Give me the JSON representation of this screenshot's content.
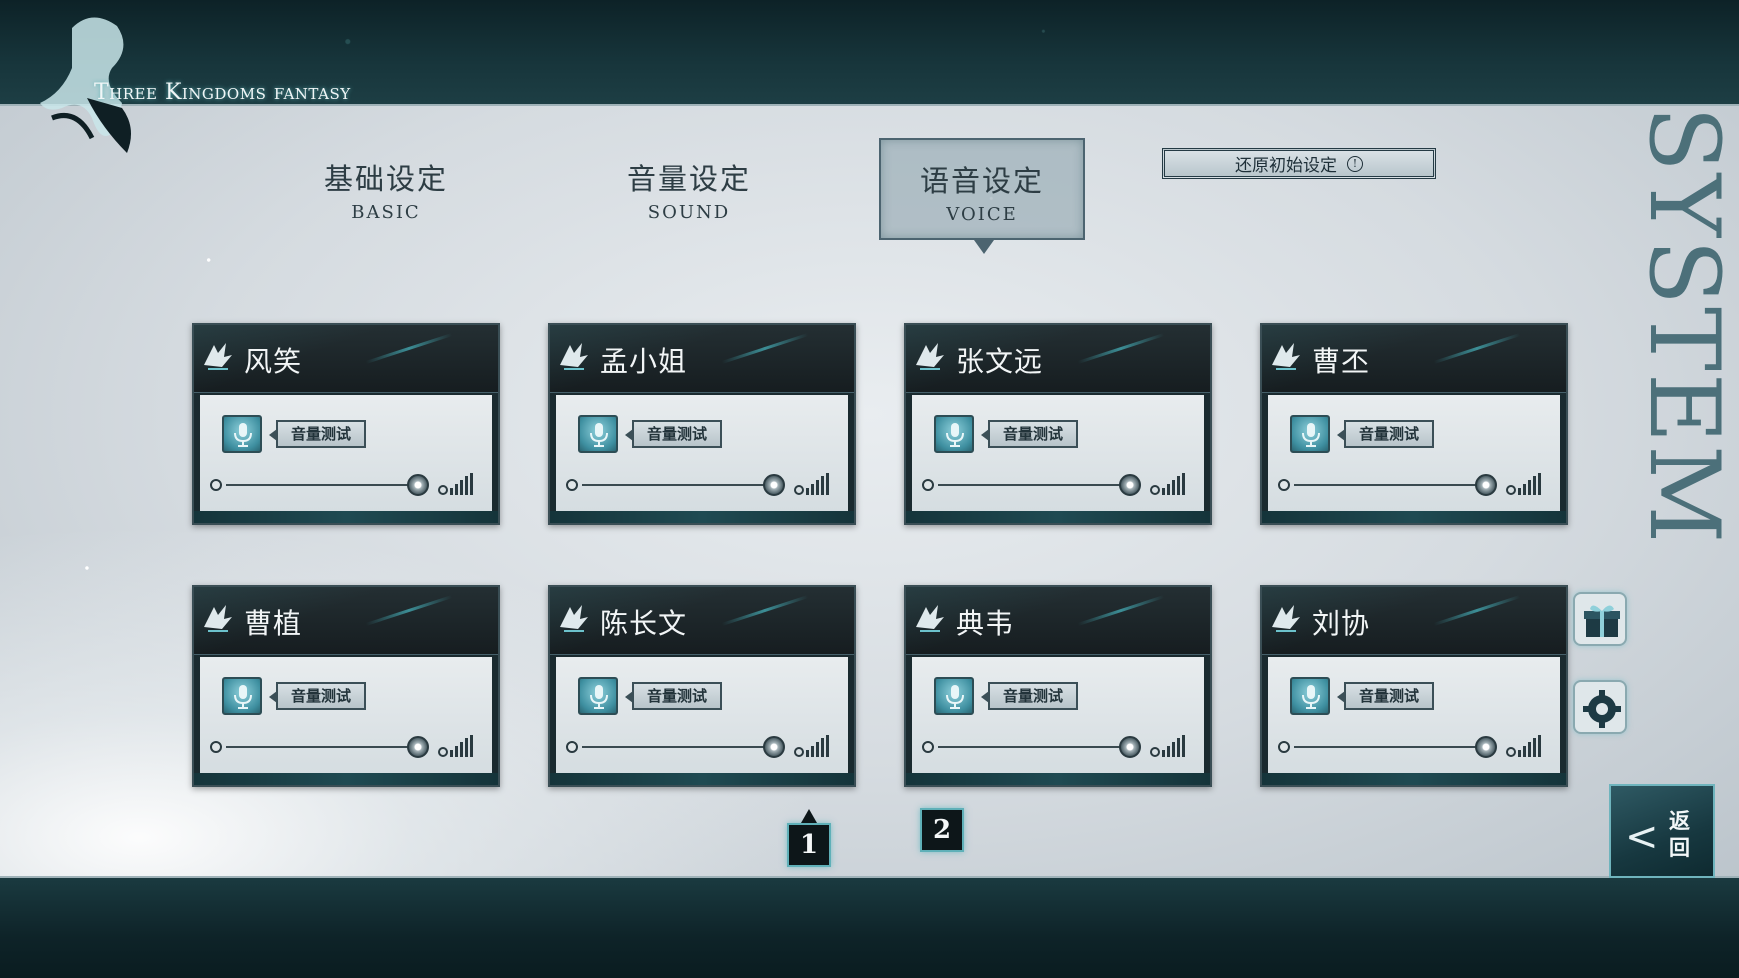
{
  "app": {
    "logo_text": "Three Kingdoms fantasy",
    "side_title": "SYSTEM"
  },
  "tabs": [
    {
      "cn": "基础设定",
      "en": "BASIC",
      "active": false
    },
    {
      "cn": "音量设定",
      "en": "SOUND",
      "active": false
    },
    {
      "cn": "语音设定",
      "en": "VOICE",
      "active": true
    }
  ],
  "reset": {
    "label": "还原初始设定",
    "icon": "info-icon"
  },
  "test_label": "音量测试",
  "characters": [
    {
      "name": "风笑",
      "volume": 1.0
    },
    {
      "name": "孟小姐",
      "volume": 1.0
    },
    {
      "name": "张文远",
      "volume": 1.0
    },
    {
      "name": "曹丕",
      "volume": 1.0
    },
    {
      "name": "曹植",
      "volume": 1.0
    },
    {
      "name": "陈长文",
      "volume": 1.0
    },
    {
      "name": "典韦",
      "volume": 1.0
    },
    {
      "name": "刘协",
      "volume": 1.0
    }
  ],
  "pagination": {
    "pages": [
      "1",
      "2"
    ],
    "current": "1"
  },
  "side_icons": [
    "gift-icon",
    "gear-icon"
  ],
  "back": {
    "label": "返回",
    "icon": "chevron-left-icon"
  },
  "colors": {
    "accent": "#5fb0b8",
    "dark": "#1a2a2f",
    "panel": "#d5dbe0"
  }
}
